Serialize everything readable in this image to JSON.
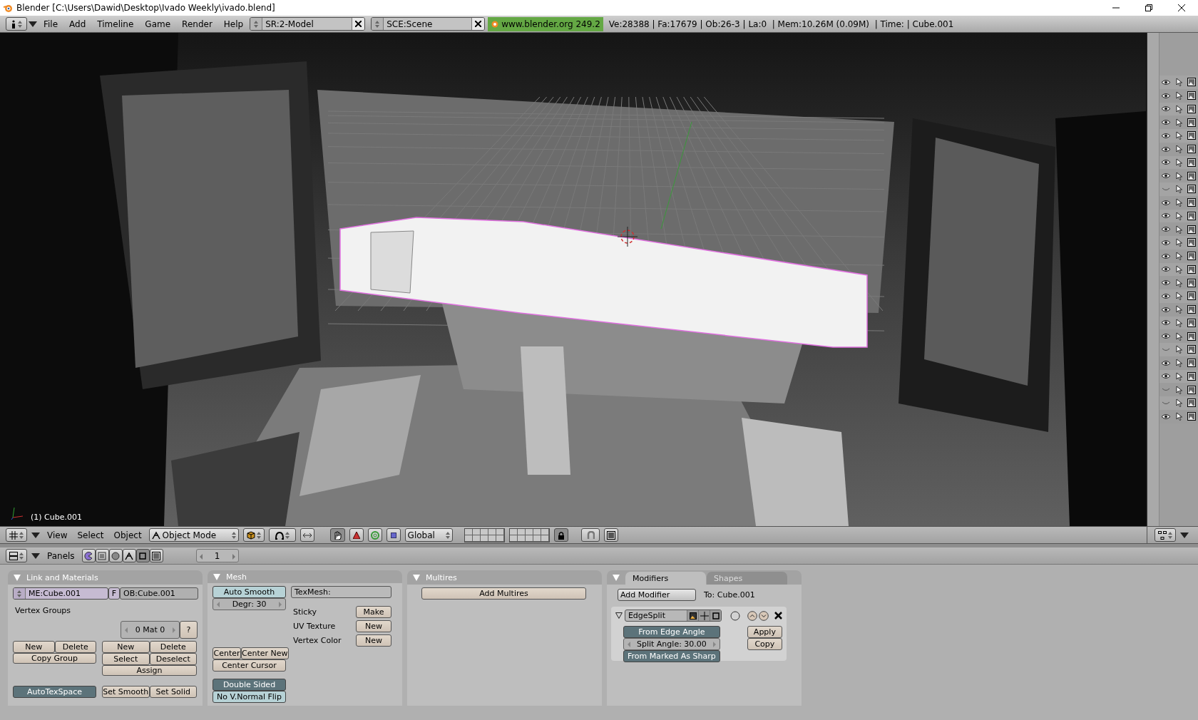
{
  "window": {
    "title": "Blender [C:\\Users\\Dawid\\Desktop\\Ivado Weekly\\ivado.blend]"
  },
  "menu_bar": {
    "menus": [
      "File",
      "Add",
      "Timeline",
      "Game",
      "Render",
      "Help"
    ],
    "screen": "SR:2-Model",
    "scene": "SCE:Scene",
    "version": "www.blender.org 249.2",
    "stats": "Ve:28388 | Fa:17679 | Ob:26-3 | La:0  | Mem:10.26M (0.09M)  | Time: | Cube.001"
  },
  "viewport": {
    "object_label": "(1) Cube.001"
  },
  "outliner": {
    "rows": [
      {
        "visible": true
      },
      {
        "visible": true
      },
      {
        "visible": true
      },
      {
        "visible": true
      },
      {
        "visible": true
      },
      {
        "visible": true
      },
      {
        "visible": true
      },
      {
        "visible": true
      },
      {
        "visible": false
      },
      {
        "visible": true
      },
      {
        "visible": true
      },
      {
        "visible": true
      },
      {
        "visible": true
      },
      {
        "visible": true
      },
      {
        "visible": true
      },
      {
        "visible": true
      },
      {
        "visible": true
      },
      {
        "visible": true
      },
      {
        "visible": true
      },
      {
        "visible": true
      },
      {
        "visible": false
      },
      {
        "visible": true
      },
      {
        "visible": true
      },
      {
        "visible": false
      },
      {
        "visible": false
      },
      {
        "visible": true
      }
    ]
  },
  "view_header": {
    "menus": [
      "View",
      "Select",
      "Object"
    ],
    "mode": "Object Mode",
    "orientation": "Global"
  },
  "buttons_header": {
    "label": "Panels",
    "frame": "1"
  },
  "link_materials": {
    "title": "Link and Materials",
    "mesh_field": "ME:Cube.001",
    "f_button": "F",
    "object_field": "OB:Cube.001",
    "vertex_groups": "Vertex Groups",
    "material": "0 Mat 0",
    "help": "?",
    "group_buttons": [
      "New",
      "Delete",
      "Copy Group"
    ],
    "material_buttons": [
      "New",
      "Delete",
      "Select",
      "Deselect",
      "Assign"
    ],
    "auto_tex_space": {
      "label": "AutoTexSpace",
      "on": true
    },
    "smooth_buttons": [
      "Set Smooth",
      "Set Solid"
    ]
  },
  "mesh": {
    "title": "Mesh",
    "auto_smooth": {
      "label": "Auto Smooth",
      "on": false
    },
    "degree": "Degr: 30",
    "center_buttons": [
      "Center",
      "Center New",
      "Center Cursor"
    ],
    "double_sided": {
      "label": "Double Sided",
      "on": true
    },
    "normal_flip": {
      "label": "No V.Normal Flip",
      "on": false
    },
    "tex_mesh": "TexMesh:",
    "rows": [
      {
        "label": "Sticky",
        "button": "Make"
      },
      {
        "label": "UV Texture",
        "button": "New"
      },
      {
        "label": "Vertex Color",
        "button": "New"
      }
    ]
  },
  "multires": {
    "title": "Multires",
    "button": "Add Multires"
  },
  "modifiers": {
    "tabs": [
      {
        "label": "Modifiers",
        "selected": true
      },
      {
        "label": "Shapes",
        "selected": false
      }
    ],
    "add_modifier": "Add Modifier",
    "target": "To: Cube.001",
    "modifier": {
      "name": "EdgeSplit",
      "expanded": true,
      "from_edge_angle": {
        "label": "From Edge Angle",
        "on": true
      },
      "split_angle": "Split Angle: 30.00",
      "from_sharp": {
        "label": "From Marked As Sharp",
        "on": true
      },
      "buttons": [
        "Apply",
        "Copy"
      ]
    }
  }
}
